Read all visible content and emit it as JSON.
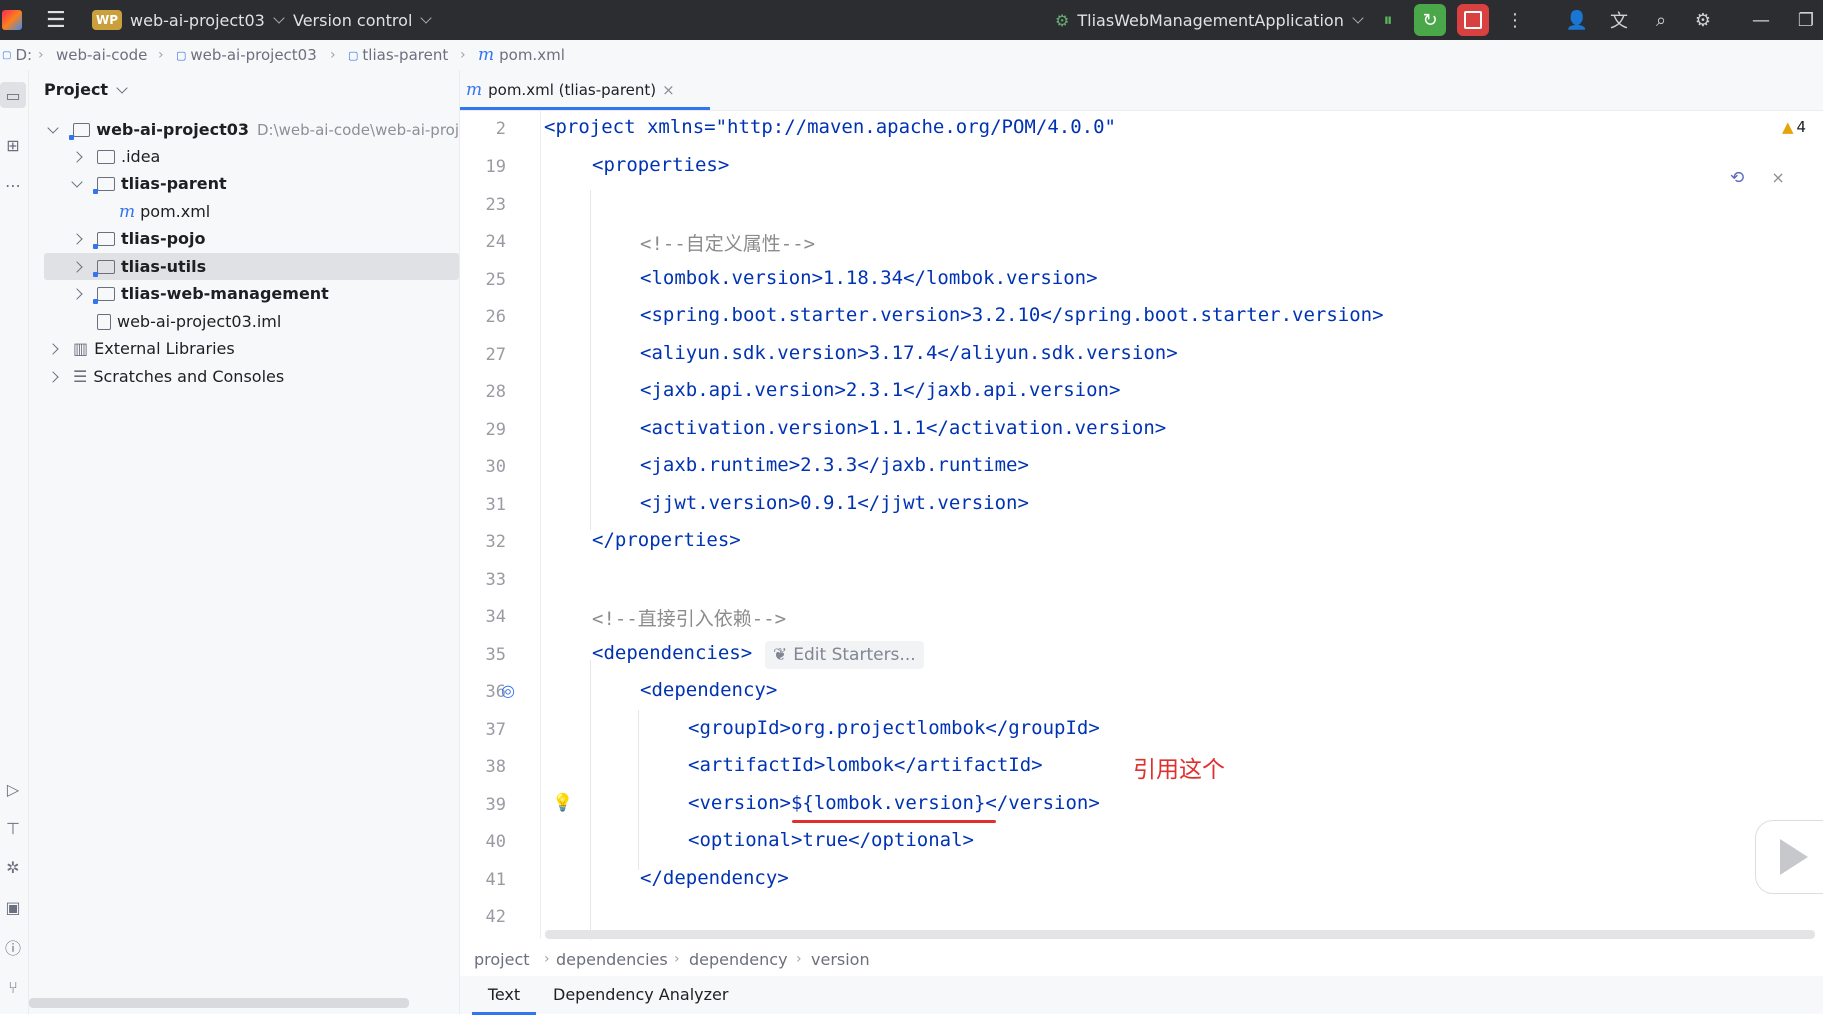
{
  "titlebar": {
    "app_badge": "WP",
    "project_name": "web-ai-project03",
    "vcs": "Version control",
    "run_config": "TliasWebManagementApplication"
  },
  "navbar": {
    "items": [
      "D:",
      "web-ai-code",
      "web-ai-project03",
      "tlias-parent",
      "pom.xml"
    ]
  },
  "project_panel": {
    "title": "Project",
    "rows": [
      {
        "label": "web-ai-project03",
        "path": "D:\\web-ai-code\\web-ai-proj"
      },
      {
        "label": ".idea"
      },
      {
        "label": "tlias-parent"
      },
      {
        "label": "pom.xml"
      },
      {
        "label": "tlias-pojo"
      },
      {
        "label": "tlias-utils"
      },
      {
        "label": "tlias-web-management"
      },
      {
        "label": "web-ai-project03.iml"
      },
      {
        "label": "External Libraries"
      },
      {
        "label": "Scratches and Consoles"
      }
    ]
  },
  "editor": {
    "tab_label": "pom.xml (tlias-parent)",
    "warning_count": "4",
    "edit_starters": "Edit Starters...",
    "lines": [
      {
        "n": "2",
        "text": "<project xmlns=\"http://maven.apache.org/POM/4.0.0\""
      },
      {
        "n": "19",
        "text": "<properties>"
      },
      {
        "n": "23",
        "text": ""
      },
      {
        "n": "24",
        "text": "<!--自定义属性-->"
      },
      {
        "n": "25",
        "text": "<lombok.version>1.18.34</lombok.version>"
      },
      {
        "n": "26",
        "text": "<spring.boot.starter.version>3.2.10</spring.boot.starter.version>"
      },
      {
        "n": "27",
        "text": "<aliyun.sdk.version>3.17.4</aliyun.sdk.version>"
      },
      {
        "n": "28",
        "text": "<jaxb.api.version>2.3.1</jaxb.api.version>"
      },
      {
        "n": "29",
        "text": "<activation.version>1.1.1</activation.version>"
      },
      {
        "n": "30",
        "text": "<jaxb.runtime>2.3.3</jaxb.runtime>"
      },
      {
        "n": "31",
        "text": "<jjwt.version>0.9.1</jjwt.version>"
      },
      {
        "n": "32",
        "text": "</properties>"
      },
      {
        "n": "33",
        "text": ""
      },
      {
        "n": "34",
        "text": "<!--直接引入依赖-->"
      },
      {
        "n": "35",
        "text": "<dependencies>"
      },
      {
        "n": "36",
        "text": "<dependency>"
      },
      {
        "n": "37",
        "text": "<groupId>org.projectlombok</groupId>"
      },
      {
        "n": "38",
        "text": "<artifactId>lombok</artifactId>"
      },
      {
        "n": "39",
        "text": "<version>${lombok.version}</version>"
      },
      {
        "n": "40",
        "text": "<optional>true</optional>"
      },
      {
        "n": "41",
        "text": "</dependency>"
      },
      {
        "n": "42",
        "text": ""
      }
    ]
  },
  "annotation": "引用这个",
  "bottom_breadcrumb": [
    "project",
    "dependencies",
    "dependency",
    "version"
  ],
  "bottom_tabs": [
    "Text",
    "Dependency Analyzer"
  ],
  "colors": {
    "accent": "#3574f0",
    "tag": "#0033b3",
    "comment": "#8c8c8c",
    "annotation": "#e0302e",
    "titlebar": "#2b2d30"
  }
}
